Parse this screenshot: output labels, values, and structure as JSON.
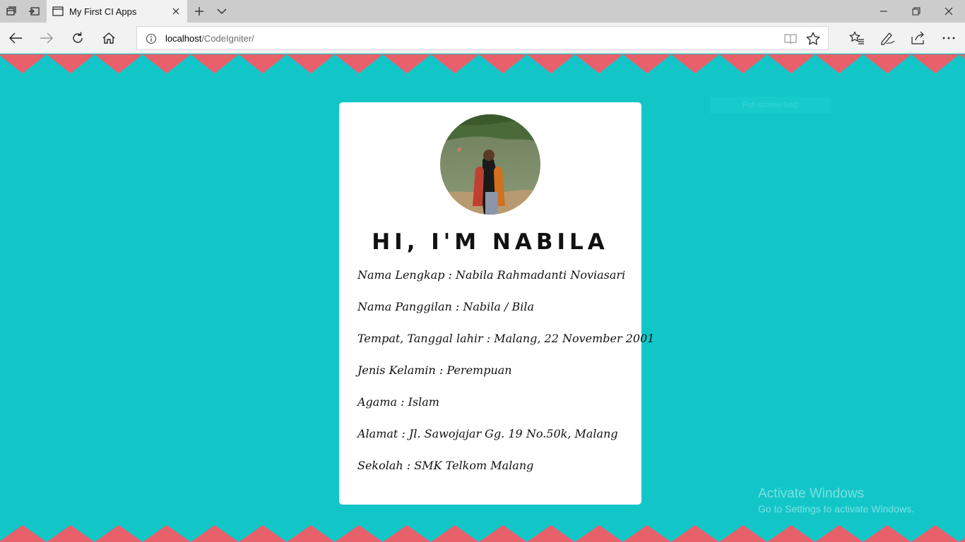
{
  "browser": {
    "tab_title": "My First CI Apps",
    "address_host": "localhost",
    "address_path": "/CodeIgniter/"
  },
  "profile": {
    "heading": "HI, I'M NABILA",
    "rows": [
      "Nama Lengkap : Nabila Rahmadanti Noviasari",
      "Nama Panggilan : Nabila / Bila",
      "Tempat, Tanggal lahir : Malang, 22 November 2001",
      "Jenis Kelamin : Perempuan",
      "Agama : Islam",
      "Alamat : Jl. Sawojajar Gg. 19 No.50k, Malang",
      "Sekolah : SMK Telkom Malang"
    ]
  },
  "overlay": {
    "fullscreen_snip": "Full-screen Snip",
    "activate_title": "Activate Windows",
    "activate_sub": "Go to Settings to activate Windows."
  },
  "colors": {
    "background": "#12c6c8",
    "zigzag": "#e8606a",
    "card": "#ffffff"
  },
  "icons": [
    "tab-manager-icon",
    "set-aside-tabs-icon",
    "tab-icon",
    "close-icon",
    "new-tab-icon",
    "tab-list-icon",
    "minimize-icon",
    "restore-icon",
    "window-close-icon",
    "back-icon",
    "forward-icon",
    "refresh-icon",
    "home-icon",
    "info-icon",
    "reading-view-icon",
    "favorite-star-icon",
    "favorites-hub-icon",
    "web-note-icon",
    "share-icon",
    "more-icon"
  ]
}
